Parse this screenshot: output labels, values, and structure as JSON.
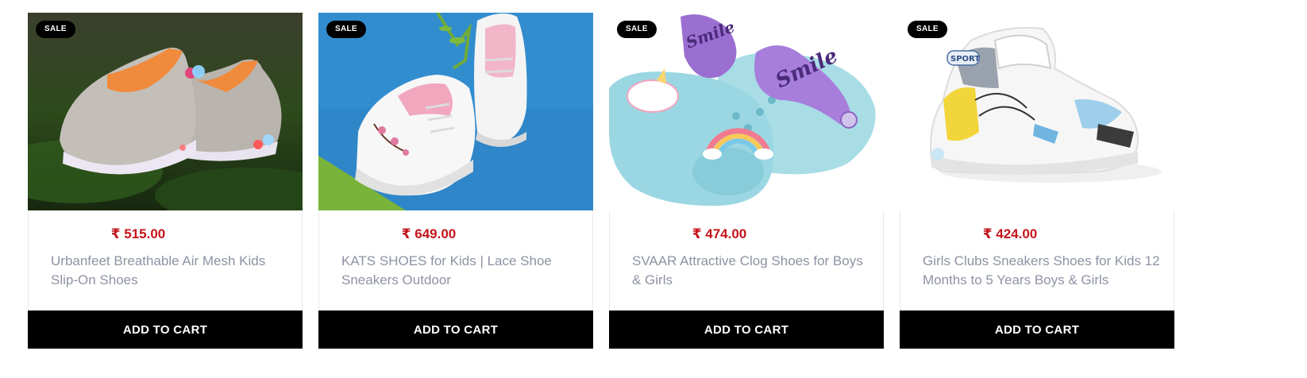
{
  "products": [
    {
      "badge": "SALE",
      "price": "₹ 515.00",
      "title": "Urbanfeet Breathable Air Mesh Kids Slip-On Shoes",
      "button": "ADD TO CART",
      "image_desc": "orange-grey-light-up-slip-on-shoes-on-moss"
    },
    {
      "badge": "SALE",
      "price": "₹ 649.00",
      "title": "KATS SHOES for Kids | Lace Shoe Sneakers Outdoor",
      "button": "ADD TO CART",
      "image_desc": "white-pink-floral-lace-sneakers-on-blue"
    },
    {
      "badge": "SALE",
      "price": "₹ 474.00",
      "title": "SVAAR Attractive Clog Shoes for Boys & Girls",
      "button": "ADD TO CART",
      "image_desc": "light-blue-clogs-purple-smile-strap",
      "image_text": "Smile"
    },
    {
      "badge": "SALE",
      "price": "₹ 424.00",
      "title": "Girls Clubs Sneakers Shoes for Kids 12 Months to 5 Years Boys & Girls",
      "button": "ADD TO CART",
      "image_desc": "white-sport-high-top-sneaker",
      "image_text": "SPORT"
    }
  ],
  "colors": {
    "price": "#c4141a",
    "title": "#8d93a3",
    "button_bg": "#000000",
    "badge_bg": "#000000"
  }
}
